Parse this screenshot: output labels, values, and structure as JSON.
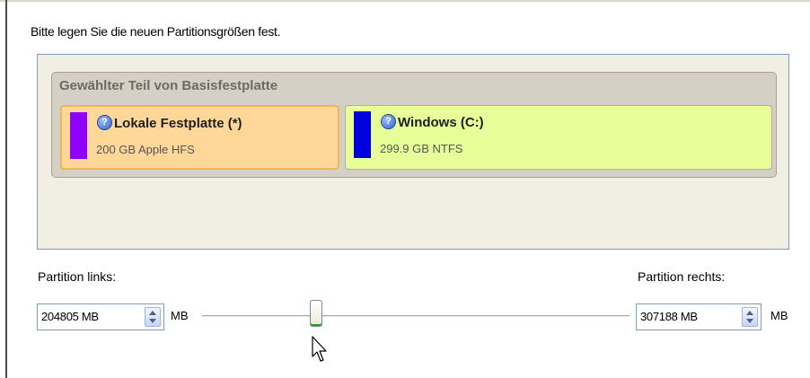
{
  "instruction": "Bitte legen Sie die neuen Partitionsgrößen fest.",
  "disk": {
    "title": "Gewählter Teil von Basisfestplatte",
    "partitions": [
      {
        "name": "Lokale Festplatte (*)",
        "desc": "200 GB Apple HFS",
        "color": "#8f00ff",
        "selected": true
      },
      {
        "name": "Windows (C:)",
        "desc": "299.9 GB NTFS",
        "color": "#0000dd",
        "selected": false
      }
    ]
  },
  "left": {
    "label": "Partition links:",
    "value": "204805 MB",
    "unit": "MB"
  },
  "right": {
    "label": "Partition rechts:",
    "value": "307188 MB",
    "unit": "MB"
  },
  "slider": {
    "position_fraction": 0.25
  },
  "icons": {
    "help": "help-icon",
    "spin": "spin-arrows-icon",
    "cursor": "mouse-pointer-icon"
  },
  "colors": {
    "selected_partition": "#ffd899",
    "other_partition": "#e8ff99",
    "accent_green": "#21a121"
  }
}
